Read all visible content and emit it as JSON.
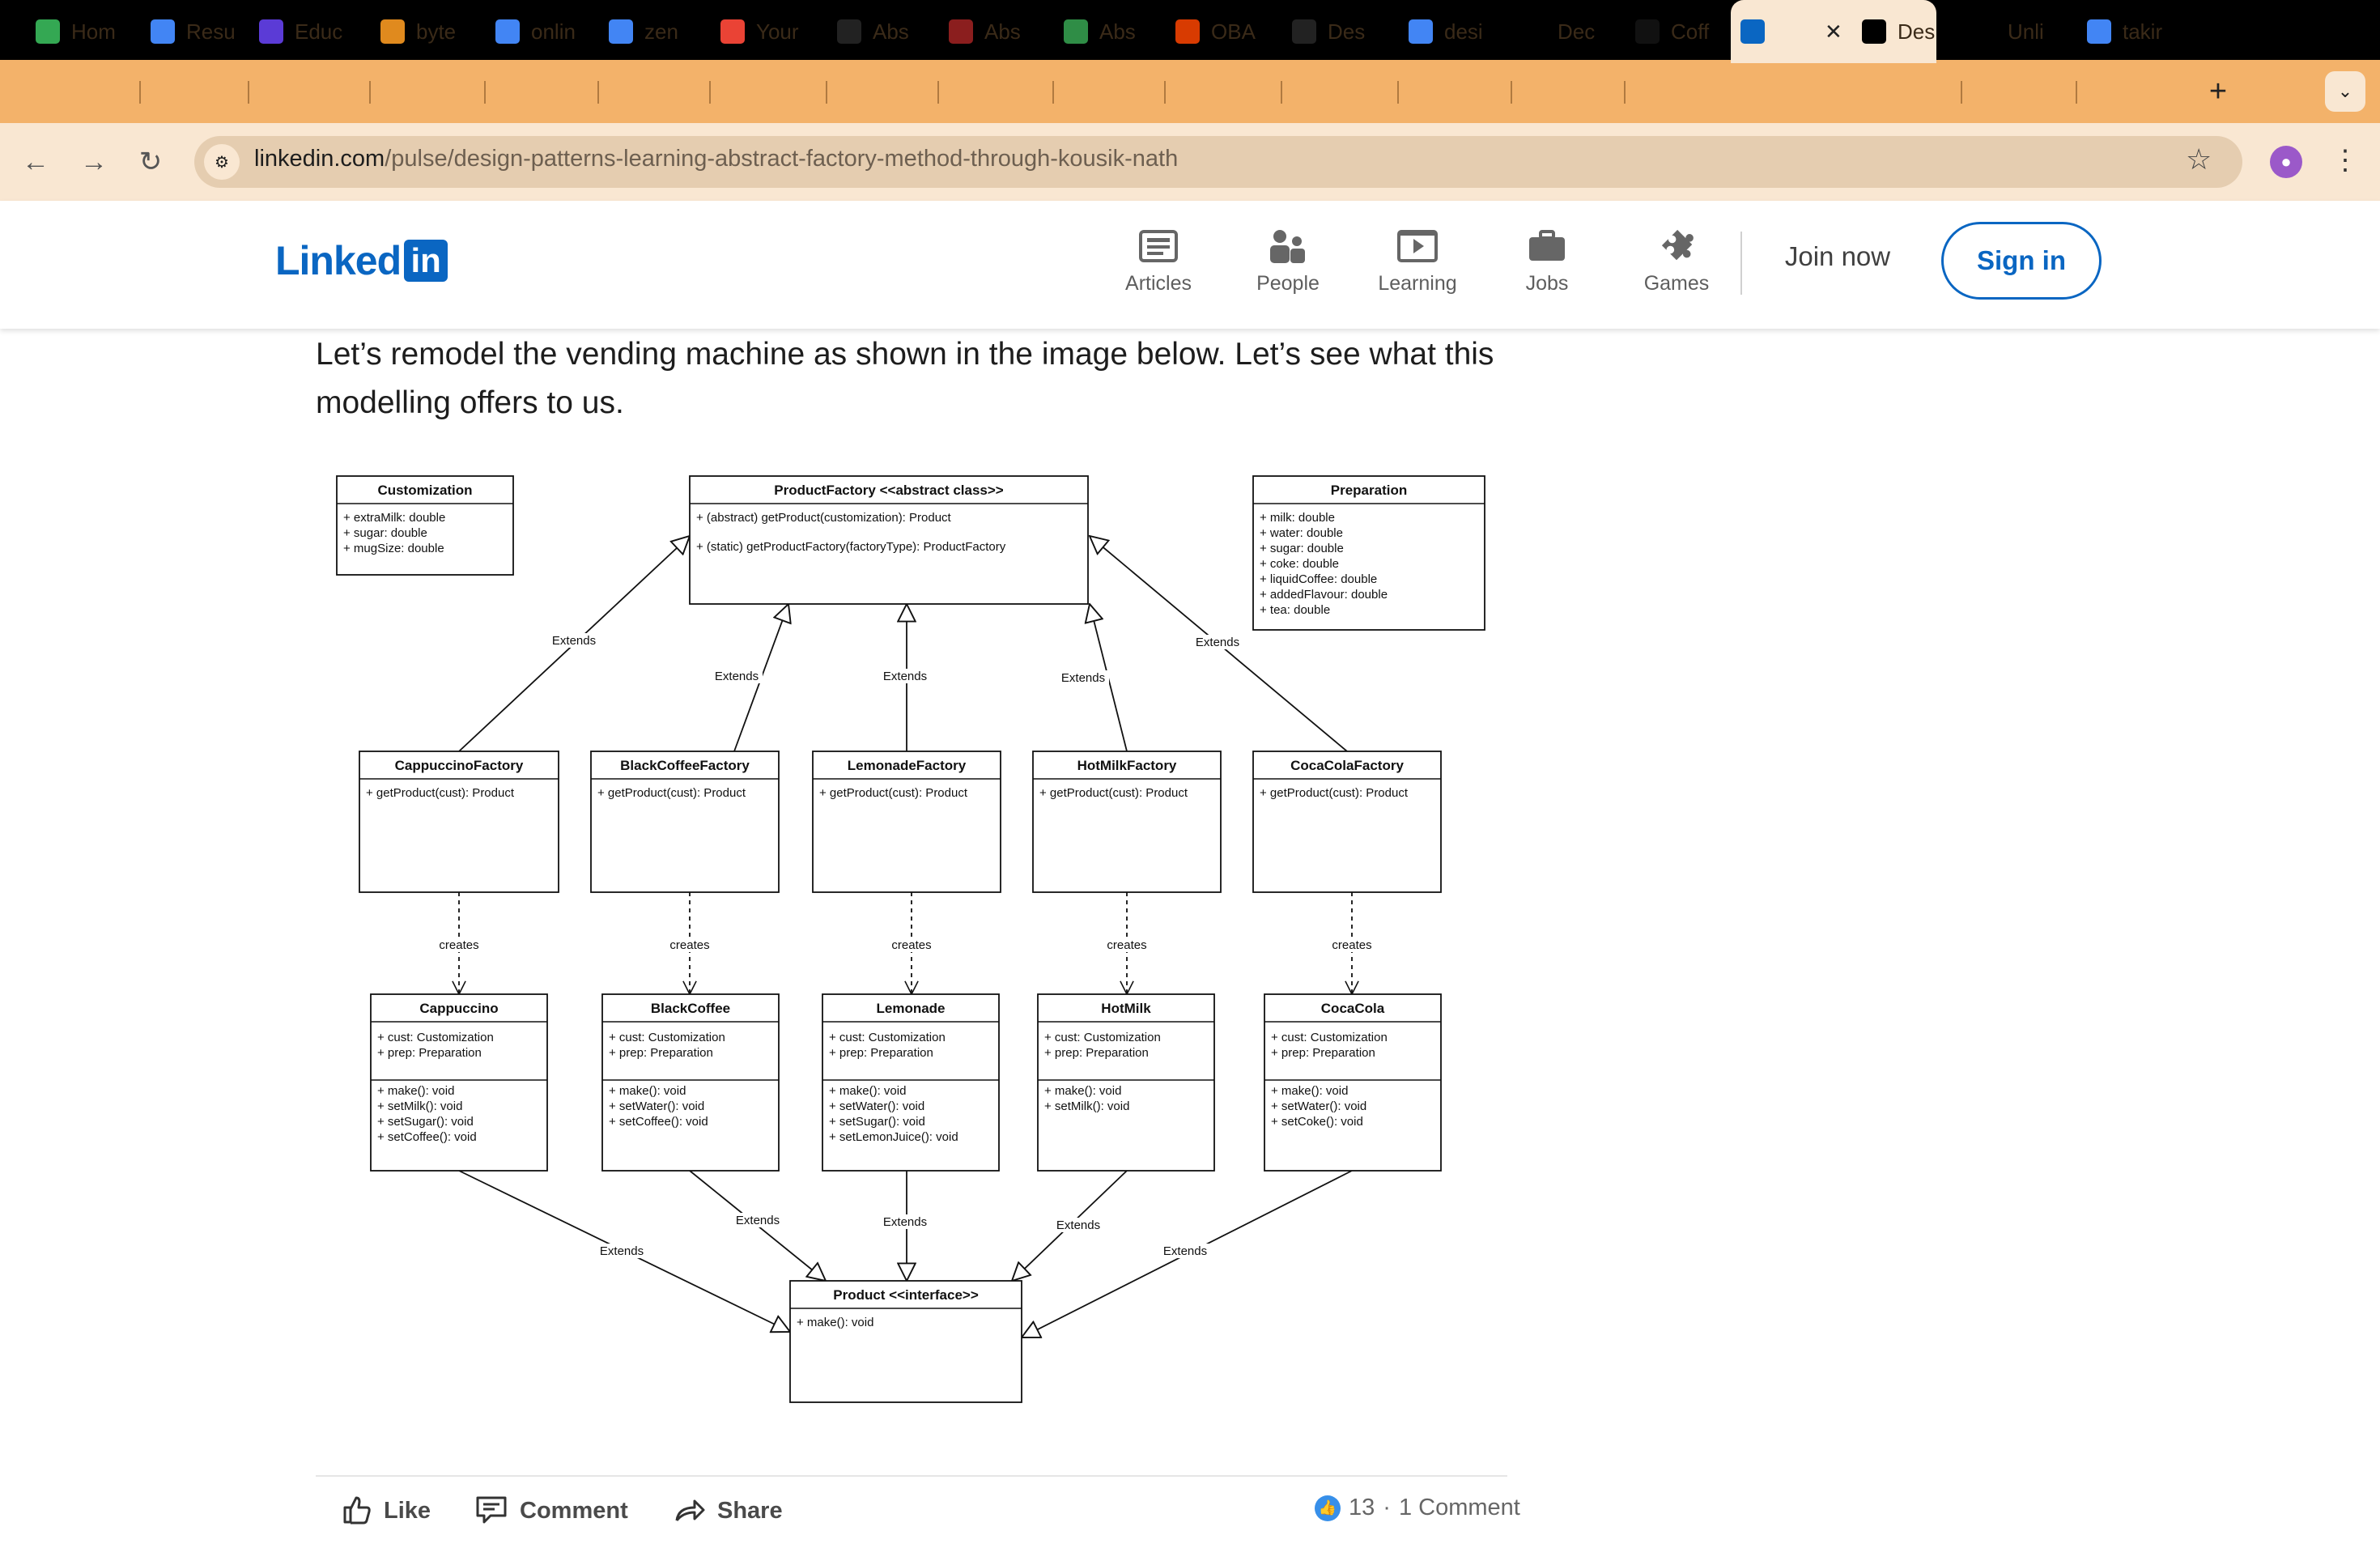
{
  "browser": {
    "tabs": [
      {
        "label": "Hom",
        "icon": "google-drive-icon",
        "color": "#34a853"
      },
      {
        "label": "Resu",
        "icon": "google-docs-icon",
        "color": "#4285f4"
      },
      {
        "label": "Educ",
        "icon": "terminal-icon",
        "color": "#5b3bd6"
      },
      {
        "label": "byte",
        "icon": "github-icon",
        "color": "#e08a1e"
      },
      {
        "label": "onlin",
        "icon": "google-icon",
        "color": "#4285f4"
      },
      {
        "label": "zen",
        "icon": "google-icon",
        "color": "#4285f4"
      },
      {
        "label": "Your",
        "icon": "gmail-icon",
        "color": "#ea4335"
      },
      {
        "label": "Abs",
        "icon": "wikipedia-icon",
        "color": "#222222"
      },
      {
        "label": "Abs",
        "icon": "owl-icon",
        "color": "#8b1e1e"
      },
      {
        "label": "Abs",
        "icon": "geeksforgeeks-icon",
        "color": "#2f8d46"
      },
      {
        "label": "OBA",
        "icon": "office-icon",
        "color": "#d83b01"
      },
      {
        "label": "Des",
        "icon": "github-icon",
        "color": "#222222"
      },
      {
        "label": "desi",
        "icon": "google-icon",
        "color": "#4285f4"
      },
      {
        "label": "Dec",
        "icon": "medium-icon",
        "color": "#000000"
      },
      {
        "label": "Coff",
        "icon": "o-icon",
        "color": "#111111"
      },
      {
        "label": "",
        "icon": "linkedin-icon",
        "color": "#0a66c2",
        "active": true
      },
      {
        "label": "Des",
        "icon": "medium-icon",
        "color": "#000000"
      },
      {
        "label": "Unli",
        "icon": "medium-icon",
        "color": "#000000"
      },
      {
        "label": "takir",
        "icon": "google-icon",
        "color": "#4285f4"
      }
    ],
    "close_tab_glyph": "✕",
    "new_tab_glyph": "+",
    "tab_menu_glyph": "⌄",
    "url_domain": "linkedin.com",
    "url_path": "/pulse/design-patterns-learning-abstract-factory-method-through-kousik-nath",
    "back_glyph": "←",
    "forward_glyph": "→",
    "reload_glyph": "↻",
    "star_glyph": "☆",
    "kebab_glyph": "⋮",
    "site_info_glyph": "⚙"
  },
  "linkedin": {
    "logo_word": "Linked",
    "logo_in": "in",
    "brand_color": "#0a66c2",
    "nav": [
      {
        "label": "Articles",
        "icon": "articles-icon"
      },
      {
        "label": "People",
        "icon": "people-icon"
      },
      {
        "label": "Learning",
        "icon": "learning-icon"
      },
      {
        "label": "Jobs",
        "icon": "jobs-icon"
      },
      {
        "label": "Games",
        "icon": "games-icon"
      }
    ],
    "join_label": "Join now",
    "signin_label": "Sign in"
  },
  "article": {
    "paragraph": "Let’s remodel the vending machine as shown in the image below. Let’s see what this modelling offers to us."
  },
  "diagram": {
    "customization": {
      "title": "Customization",
      "attrs": [
        "+ extraMilk: double",
        "+ sugar: double",
        "+ mugSize: double"
      ]
    },
    "factory": {
      "title": "ProductFactory <<abstract class>>",
      "methods": [
        "+ (abstract) getProduct(customization): Product",
        "+ (static) getProductFactory(factoryType): ProductFactory"
      ]
    },
    "preparation": {
      "title": "Preparation",
      "attrs": [
        "+ milk: double",
        "+ water: double",
        "+ sugar: double",
        "+ coke: double",
        "+ liquidCoffee: double",
        "+ addedFlavour: double",
        "+ tea: double"
      ]
    },
    "factories": [
      {
        "title": "CappuccinoFactory",
        "method": "+ getProduct(cust): Product"
      },
      {
        "title": "BlackCoffeeFactory",
        "method": "+ getProduct(cust): Product"
      },
      {
        "title": "LemonadeFactory",
        "method": "+ getProduct(cust): Product"
      },
      {
        "title": "HotMilkFactory",
        "method": "+ getProduct(cust): Product"
      },
      {
        "title": "CocaColaFactory",
        "method": "+ getProduct(cust): Product"
      }
    ],
    "products": [
      {
        "title": "Cappuccino",
        "attrs": [
          "+ cust: Customization",
          "+ prep: Preparation"
        ],
        "methods": [
          "+ make(): void",
          "+ setMilk(): void",
          "+ setSugar(): void",
          "+ setCoffee(): void"
        ]
      },
      {
        "title": "BlackCoffee",
        "attrs": [
          "+ cust: Customization",
          "+ prep: Preparation"
        ],
        "methods": [
          "+ make(): void",
          "+ setWater(): void",
          "+ setCoffee(): void"
        ]
      },
      {
        "title": "Lemonade",
        "attrs": [
          "+ cust: Customization",
          "+ prep: Preparation"
        ],
        "methods": [
          "+ make(): void",
          "+ setWater(): void",
          "+ setSugar(): void",
          "+ setLemonJuice(): void"
        ]
      },
      {
        "title": "HotMilk",
        "attrs": [
          "+ cust: Customization",
          "+ prep: Preparation"
        ],
        "methods": [
          "+ make(): void",
          "+ setMilk(): void"
        ]
      },
      {
        "title": "CocaCola",
        "attrs": [
          "+ cust: Customization",
          "+ prep: Preparation"
        ],
        "methods": [
          "+ make(): void",
          "+ setWater(): void",
          "+ setCoke(): void"
        ]
      }
    ],
    "product_interface": {
      "title": "Product <<interface>>",
      "methods": [
        "+ make(): void"
      ]
    },
    "extends_label": "Extends",
    "creates_label": "creates"
  },
  "actions": {
    "like": "Like",
    "comment": "Comment",
    "share": "Share",
    "reaction_count": "13",
    "comments_text": "1 Comment"
  }
}
